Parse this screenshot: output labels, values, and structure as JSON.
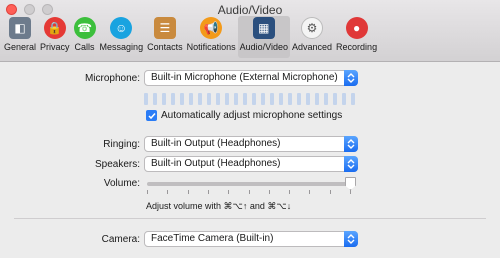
{
  "window": {
    "title": "Audio/Video"
  },
  "tabs": [
    {
      "label": "General",
      "icon": "general-icon",
      "color": "#6d7b8c",
      "glyph": "◧"
    },
    {
      "label": "Privacy",
      "icon": "lock-icon",
      "color": "#e53935",
      "glyph": "🔒"
    },
    {
      "label": "Calls",
      "icon": "phone-icon",
      "color": "#3cbf3c",
      "glyph": "☎"
    },
    {
      "label": "Messaging",
      "icon": "chat-bubble-icon",
      "color": "#19a3e0",
      "glyph": "☺"
    },
    {
      "label": "Contacts",
      "icon": "address-book-icon",
      "color": "#c98a3e",
      "glyph": "☰"
    },
    {
      "label": "Notifications",
      "icon": "megaphone-icon",
      "color": "#f39a1a",
      "glyph": "📢"
    },
    {
      "label": "Audio/Video",
      "icon": "audio-video-icon",
      "color": "#2b4f7e",
      "glyph": "▦"
    },
    {
      "label": "Advanced",
      "icon": "gear-icon",
      "color": "#f4f4f4",
      "glyph": "⚙"
    },
    {
      "label": "Recording",
      "icon": "record-icon",
      "color": "#e03838",
      "glyph": "●"
    }
  ],
  "active_tab": "Audio/Video",
  "microphone": {
    "label": "Microphone:",
    "value": "Built-in Microphone (External Microphone)",
    "auto_adjust_label": "Automatically adjust microphone settings",
    "auto_adjust_checked": true,
    "level": 0
  },
  "ringing": {
    "label": "Ringing:",
    "value": "Built-in Output (Headphones)"
  },
  "speakers": {
    "label": "Speakers:",
    "value": "Built-in Output (Headphones)"
  },
  "volume": {
    "label": "Volume:",
    "level": 1.0,
    "hint": "Adjust volume with ⌘⌥↑ and ⌘⌥↓"
  },
  "camera": {
    "label": "Camera:",
    "value": "FaceTime Camera (Built-in)"
  },
  "colors": {
    "accent": "#1a6cf0",
    "close": "#ff5f57"
  }
}
